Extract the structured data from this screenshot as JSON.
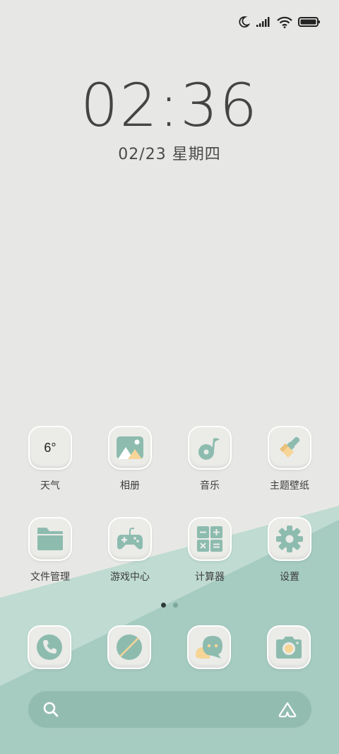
{
  "status_bar": {
    "icons": [
      "moon-icon",
      "signal-icon",
      "wifi-icon",
      "battery-icon"
    ]
  },
  "clock": {
    "time": "02:36",
    "date": "02/23 星期四"
  },
  "apps": [
    {
      "label": "天气",
      "icon": "weather-icon",
      "value": "6°"
    },
    {
      "label": "相册",
      "icon": "gallery-icon"
    },
    {
      "label": "音乐",
      "icon": "music-icon"
    },
    {
      "label": "主题壁纸",
      "icon": "theme-brush-icon"
    },
    {
      "label": "文件管理",
      "icon": "folder-icon"
    },
    {
      "label": "游戏中心",
      "icon": "gamepad-icon"
    },
    {
      "label": "计算器",
      "icon": "calculator-icon"
    },
    {
      "label": "设置",
      "icon": "gear-icon"
    }
  ],
  "dock": [
    {
      "icon": "phone-icon"
    },
    {
      "icon": "browser-icon"
    },
    {
      "icon": "messages-icon"
    },
    {
      "icon": "camera-icon"
    }
  ],
  "page_indicator": {
    "pages": 2,
    "current": 1
  },
  "search_bar": {
    "icons": [
      "search-icon",
      "assistant-icon"
    ]
  },
  "colors": {
    "background": "#e7e8e5",
    "accent": "#8dbcaf",
    "wallpaper_light": "#bfdbd2",
    "wallpaper_dark": "#a6cbc1",
    "yellow": "#f6d597"
  }
}
